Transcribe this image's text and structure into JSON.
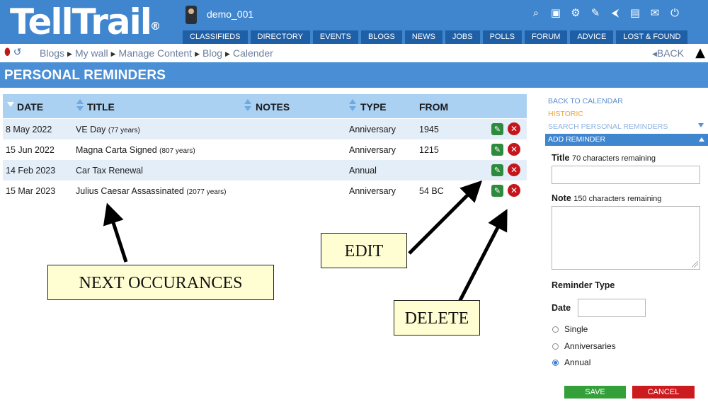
{
  "header": {
    "logo_text": "TellTrail",
    "logo_mark": "®",
    "username": "demo_001",
    "top_icons": [
      "search-icon",
      "camera-icon",
      "gear-icon",
      "edit-icon",
      "share-icon",
      "translate-icon",
      "mail-icon",
      "power-icon"
    ],
    "nav_tabs": [
      "CLASSIFIEDS",
      "DIRECTORY",
      "EVENTS",
      "BLOGS",
      "NEWS",
      "JOBS",
      "POLLS",
      "FORUM",
      "ADVICE",
      "LOST & FOUND"
    ]
  },
  "breadcrumb": {
    "items": [
      "Blogs",
      "My wall",
      "Manage Content",
      "Blog",
      "Calender"
    ],
    "back_label": "BACK"
  },
  "page": {
    "title": "PERSONAL REMINDERS"
  },
  "table": {
    "columns": [
      "DATE",
      "TITLE",
      "NOTES",
      "TYPE",
      "FROM"
    ],
    "rows": [
      {
        "date": "8 May 2022",
        "title": "VE Day",
        "years": "(77 years)",
        "notes": "",
        "type": "Anniversary",
        "from": "1945"
      },
      {
        "date": "15 Jun 2022",
        "title": "Magna Carta Signed",
        "years": "(807 years)",
        "notes": "",
        "type": "Anniversary",
        "from": "1215"
      },
      {
        "date": "14 Feb 2023",
        "title": "Car Tax Renewal",
        "years": "",
        "notes": "",
        "type": "Annual",
        "from": ""
      },
      {
        "date": "15 Mar 2023",
        "title": "Julius Caesar Assassinated",
        "years": "(2077 years)",
        "notes": "",
        "type": "Anniversary",
        "from": "54 BC"
      }
    ]
  },
  "sidebar": {
    "back_to_calendar": "BACK TO CALENDAR",
    "historic": "HISTORIC",
    "search": "SEARCH PERSONAL REMINDERS",
    "add_reminder": "ADD REMINDER",
    "title_label": "Title",
    "title_remaining": "70 characters remaining",
    "note_label": "Note",
    "note_remaining": "150 characters remaining",
    "reminder_type_label": "Reminder Type",
    "date_label": "Date",
    "options": [
      "Single",
      "Anniversaries",
      "Annual"
    ],
    "selected_option": "Annual",
    "save_label": "SAVE",
    "cancel_label": "CANCEL",
    "link_color": "#5b8fcf",
    "historic_color": "#f0a33a"
  },
  "annotations": {
    "next": "NEXT OCCURANCES",
    "edit": "EDIT",
    "delete": "DELETE"
  },
  "colors": {
    "header_blue": "#3f86cf",
    "title_blue": "#4a8fd6",
    "table_head": "#aad0f2",
    "row_alt": "#e4eef9",
    "edit_green": "#2e8b3e",
    "delete_red": "#c4161c"
  }
}
